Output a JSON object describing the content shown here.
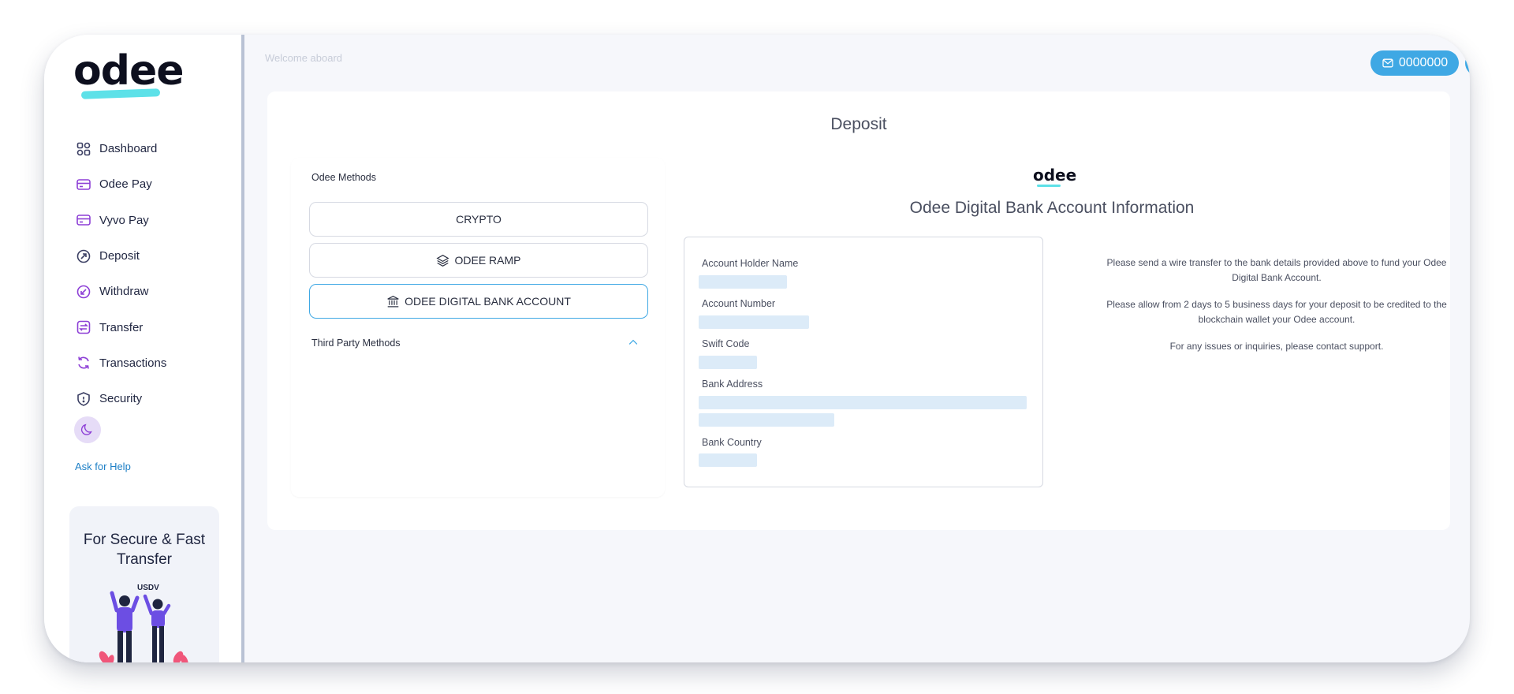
{
  "brand": {
    "logo_text": "odee"
  },
  "sidebar": {
    "items": [
      {
        "label": "Dashboard",
        "icon": "grid-icon"
      },
      {
        "label": "Odee Pay",
        "icon": "card-icon"
      },
      {
        "label": "Vyvo Pay",
        "icon": "card-icon"
      },
      {
        "label": "Deposit",
        "icon": "arrow-up-right-circle-icon"
      },
      {
        "label": "Withdraw",
        "icon": "arrow-down-left-circle-icon"
      },
      {
        "label": "Transfer",
        "icon": "transfer-icon"
      },
      {
        "label": "Transactions",
        "icon": "refresh-icon"
      },
      {
        "label": "Security",
        "icon": "shield-icon"
      }
    ],
    "help_label": "Ask for Help",
    "promo": {
      "title": "For Secure & Fast Transfer",
      "art_label": "USDV"
    }
  },
  "header": {
    "welcome_text": "Welcome aboard",
    "account_number": "0000000"
  },
  "deposit": {
    "title": "Deposit",
    "methods_label": "Odee Methods",
    "methods": [
      {
        "label": "CRYPTO",
        "icon": "",
        "active": false
      },
      {
        "label": "ODEE RAMP",
        "icon": "layers-icon",
        "active": false
      },
      {
        "label": "ODEE DIGITAL BANK ACCOUNT",
        "icon": "bank-icon",
        "active": true
      }
    ],
    "third_party_label": "Third Party Methods",
    "info_logo": "odee",
    "info_title": "Odee Digital Bank Account Information",
    "fields": [
      {
        "label": "Account Holder Name"
      },
      {
        "label": "Account Number"
      },
      {
        "label": "Swift Code"
      },
      {
        "label": "Bank Address"
      },
      {
        "label": "Bank Country"
      }
    ],
    "notes": [
      "Please send a wire transfer to the bank details provided above to fund your Odee Digital Bank Account.",
      "Please allow from 2 days to 5 business days for your deposit to be credited to the blockchain wallet your Odee account.",
      "For any issues or inquiries, please contact support."
    ]
  },
  "colors": {
    "accent": "#3fa8e4",
    "brand_swash": "#5de1e8",
    "placeholder": "#dcebf8",
    "moon_bg": "#e6dcf7"
  }
}
